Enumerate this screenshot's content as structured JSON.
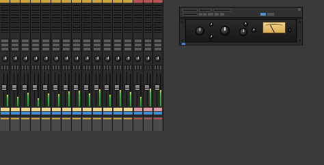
{
  "mixer": {
    "strip_count": 16,
    "colors": {
      "track_top": "#caa23a",
      "aux_top": "#b35353",
      "name_track": "#e9d48a",
      "name_aux": "#d89aa0",
      "meter_green": "#2fbf3a",
      "selector_blue": "#3f8fd0"
    },
    "strips": [
      {
        "kind": "track",
        "fader": 0.55,
        "meter": 0.35
      },
      {
        "kind": "track",
        "fader": 0.55,
        "meter": 0.3
      },
      {
        "kind": "track",
        "fader": 0.55,
        "meter": 0.42
      },
      {
        "kind": "track",
        "fader": 0.55,
        "meter": 0.25
      },
      {
        "kind": "track",
        "fader": 0.55,
        "meter": 0.4
      },
      {
        "kind": "track",
        "fader": 0.55,
        "meter": 0.38
      },
      {
        "kind": "track",
        "fader": 0.55,
        "meter": 0.45
      },
      {
        "kind": "track",
        "fader": 0.55,
        "meter": 0.48
      },
      {
        "kind": "track",
        "fader": 0.55,
        "meter": 0.4
      },
      {
        "kind": "track",
        "fader": 0.55,
        "meter": 0.52
      },
      {
        "kind": "track",
        "fader": 0.55,
        "meter": 0.36
      },
      {
        "kind": "track",
        "fader": 0.55,
        "meter": 0.5
      },
      {
        "kind": "track",
        "fader": 0.55,
        "meter": 0.44
      },
      {
        "kind": "aux",
        "fader": 0.55,
        "meter": 0.3
      },
      {
        "kind": "aux",
        "fader": 0.55,
        "meter": 0.55
      },
      {
        "kind": "aux",
        "fader": 0.55,
        "meter": 0.5
      }
    ]
  },
  "plugin": {
    "header_labels": [],
    "knob_labels": [],
    "brand_line1": "",
    "brand_line2": "",
    "vu_label": "",
    "footer_text": "",
    "colors": {
      "vu_face": "#e8c070",
      "logo_blue": "#4e80c9"
    }
  }
}
